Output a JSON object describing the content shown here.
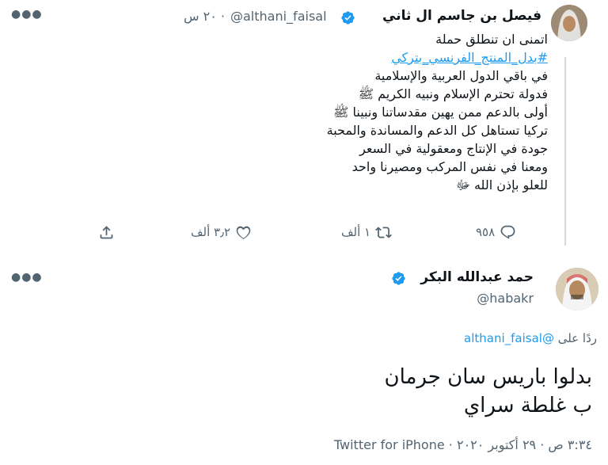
{
  "tweet1": {
    "name": "فيصل بن جاسم ال ثاني",
    "handle": "@althani_faisal",
    "separator": "·",
    "time": "٢٠ س",
    "lines": [
      "اتمنى ان تنطلق حملة",
      "#بدل_المنتج_الفرنسي_بتركي",
      "في باقي الدول العربية والإسلامية",
      "فدولة تحترم الإسلام ونبيه الكريم ﷺ",
      "أولى بالدعم ممن يهين مقدساتنا ونبينا ﷺ",
      "تركيا تستاهل كل الدعم والمساندة والمحبة",
      "جودة في الإنتاج ومعقولية في السعر",
      "ومعنا في نفس المركب ومصيرنا واحد",
      "للعلو بإذن الله ﷻ"
    ],
    "replies": "٩٥٨",
    "retweets": "١ ألف",
    "likes": "٣٫٢ ألف"
  },
  "tweet2": {
    "name": "حمد عبدالله البكر",
    "handle": "@habakr",
    "replying_prefix": "ردًا على",
    "replying_to": "@althani_faisal",
    "text_lines": [
      "بدلوا باريس سان جرمان",
      "ب غلطة سراي"
    ],
    "timestamp": "٣:٣٤ ص · ٢٩ أكتوبر ٢٠٢٠ · Twitter for iPhone"
  },
  "icons": {
    "more": "more-icon",
    "verified": "verified-badge-icon",
    "reply": "reply-icon",
    "retweet": "retweet-icon",
    "like": "like-icon",
    "share": "share-icon"
  },
  "colors": {
    "accent": "#1d9bf0",
    "secondary_text": "#536471",
    "text": "#0f1419"
  }
}
